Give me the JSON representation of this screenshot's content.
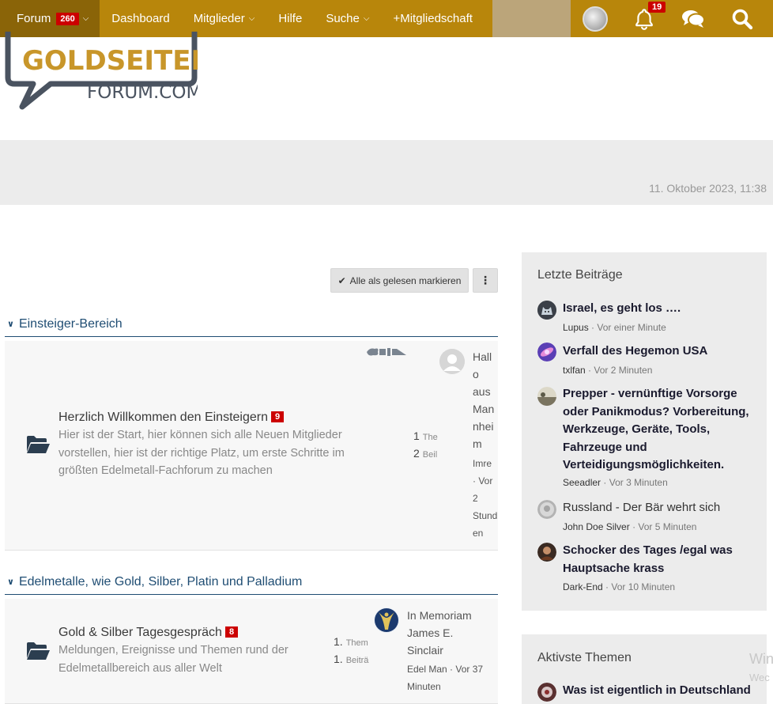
{
  "nav": {
    "forum_label": "Forum",
    "forum_badge": "260",
    "items": [
      "Dashboard",
      "Mitglieder",
      "Hilfe",
      "Suche",
      "+Mitgliedschaft"
    ],
    "bell_badge": "19"
  },
  "logo": {
    "line1": "GOLDSEITEN",
    "line2": "FORUM.COM"
  },
  "header": {
    "datetime": "11. Oktober 2023, 11:38"
  },
  "toolbar": {
    "mark_read_label": "Alle als gelesen markieren",
    "more_label": "⋮"
  },
  "categories": [
    {
      "title": "Einsteiger-Bereich",
      "board": {
        "title": "Herzlich Willkommen den Einsteigern",
        "badge": "9",
        "desc_lines": [
          "Hier ist der Start, hier können sich alle Neuen Mitglieder",
          "vorstellen, hier ist der richtige Platz, um erste Schritte im",
          "größten Edelmetall-Fachforum zu machen"
        ],
        "stats": [
          {
            "num": "1",
            "label": "The"
          },
          {
            "num": "2",
            "label": "Beil"
          }
        ],
        "last_post_title_lines": [
          "Hall",
          "o",
          "aus",
          "Man",
          "nhei",
          "m"
        ],
        "last_post_meta_lines": [
          "Imre",
          "· Vor",
          "2",
          "Stund",
          "en"
        ]
      }
    },
    {
      "title": "Edelmetalle, wie Gold, Silber, Platin und Palladium",
      "board": {
        "title": "Gold & Silber Tagesgespräch",
        "badge": "8",
        "desc_lines": [
          "Meldungen, Ereignisse und Themen rund der",
          "Edelmetallbereich aus aller Welt"
        ],
        "stats": [
          {
            "num": "1.",
            "label": "Them"
          },
          {
            "num": "1.",
            "label": "Beiträ"
          }
        ],
        "last_post_title_lines": [
          "In Memoriam",
          "James E.",
          "Sinclair"
        ],
        "last_post_meta_lines": [
          "Edel Man · Vor 37",
          "Minuten"
        ]
      }
    }
  ],
  "sidebar": {
    "recent_title": "Letzte Beiträge",
    "recent": [
      {
        "title": "Israel, es geht los ….",
        "user": "Lupus",
        "time": "· Vor einer Minute"
      },
      {
        "title": "Verfall des Hegemon USA",
        "user": "txlfan",
        "time": "· Vor 2 Minuten"
      },
      {
        "title_lines": [
          "Prepper - vernünftige Vorsorge",
          "oder Panikmodus? Vorbereitung,",
          "Werkzeuge, Geräte, Tools,",
          "Fahrzeuge und",
          "Verteidigungsmöglichkeiten."
        ],
        "user": "Seeadler",
        "time": "· Vor 3 Minuten"
      },
      {
        "title": "Russland - Der Bär wehrt sich",
        "user": "John Doe Silver",
        "time": "· Vor 5 Minuten"
      },
      {
        "title_lines": [
          "Schocker des Tages /egal was",
          "Hauptsache krass"
        ],
        "user": "Dark-End",
        "time": "· Vor 10 Minuten"
      }
    ],
    "active_title": "Aktivste Themen",
    "active_first": "Was ist eigentlich in Deutschland",
    "watermark_1": "Win",
    "watermark_2": "Wec"
  },
  "colors": {
    "nav_gold": "#b8860b",
    "nav_dark": "#8a6408",
    "link_blue": "#1f4d73",
    "badge_red": "#cc0000"
  }
}
